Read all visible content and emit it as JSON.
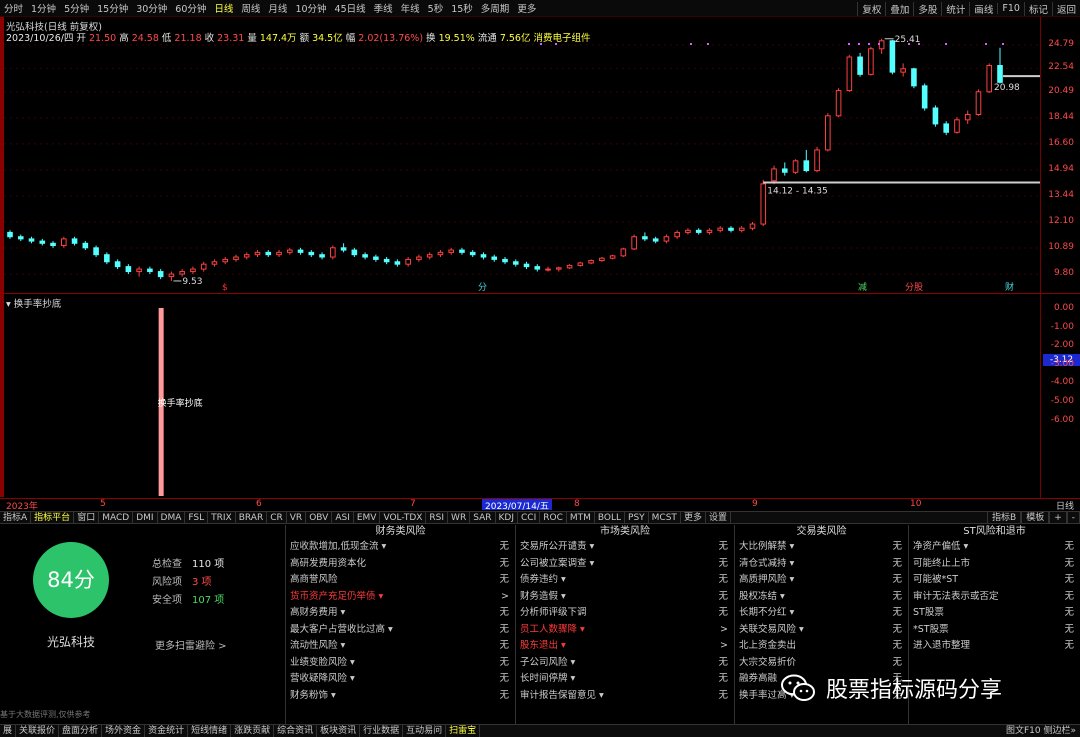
{
  "top_menu": [
    "分时",
    "1分钟",
    "5分钟",
    "15分钟",
    "30分钟",
    "60分钟",
    "日线",
    "周线",
    "月线",
    "10分钟",
    "45日线",
    "季线",
    "年线",
    "5秒",
    "15秒",
    "多周期",
    "更多"
  ],
  "top_menu_active": 6,
  "top_right": [
    "复权",
    "叠加",
    "多股",
    "统计",
    "画线",
    "F10",
    "标记",
    "返回"
  ],
  "info": {
    "title": "光弘科技(日线 前复权)",
    "date": "2023/10/26/四",
    "open_label": "开",
    "open": "21.50",
    "high_label": "高",
    "high": "24.58",
    "low_label": "低",
    "low": "21.18",
    "close_label": "收",
    "close": "23.31",
    "vol_label": "量",
    "vol": "147.4万",
    "amt_label": "额",
    "amt": "34.5亿",
    "chg_label": "幅",
    "chg": "2.02(13.76%)",
    "turn_label": "换",
    "turn": "19.51%",
    "float_label": "流通",
    "float": "7.56亿",
    "concept": "消费电子组件"
  },
  "price_axis": [
    "24.79",
    "22.54",
    "20.49",
    "18.44",
    "16.60",
    "14.94",
    "13.44",
    "12.10",
    "10.89",
    "9.80"
  ],
  "chart_annotations": {
    "high_label": "25.41",
    "low_label": "9.53",
    "gap_label": "14.12 - 14.35",
    "right_label": "20.98"
  },
  "event_marks": [
    "$",
    "分",
    "减",
    "分股",
    "财"
  ],
  "indicator": {
    "title": "换手率抄底",
    "bar_label": "换手率抄底",
    "axis": [
      "0.00",
      "-1.00",
      "-2.00",
      "-3.00",
      "-4.00",
      "-5.00",
      "-6.00"
    ],
    "current": "-3.12"
  },
  "date_axis": {
    "labels": [
      "2023年",
      "5",
      "6",
      "7",
      "8",
      "9",
      "10"
    ],
    "cursor": "2023/07/14/五",
    "right": "日线"
  },
  "tabs": [
    "指标A",
    "指标平台",
    "窗口",
    "MACD",
    "DMI",
    "DMA",
    "FSL",
    "TRIX",
    "BRAR",
    "CR",
    "VR",
    "OBV",
    "ASI",
    "EMV",
    "VOL-TDX",
    "RSI",
    "WR",
    "SAR",
    "KDJ",
    "CCI",
    "ROC",
    "MTM",
    "BOLL",
    "PSY",
    "MCST",
    "更多",
    "设置"
  ],
  "tabs_active": 1,
  "tabs_right": [
    "指标B",
    "模板",
    "+",
    "-"
  ],
  "risk": {
    "score": "84分",
    "stock_name": "光弘科技",
    "total_label": "总检查",
    "total_value": "110 项",
    "risk_label": "风险项",
    "risk_value": "3 项",
    "safe_label": "安全项",
    "safe_value": "107 项",
    "more_label": "更多扫雷避险 >",
    "disclaimer": "基于大数据评测,仅供参考",
    "columns": [
      {
        "title": "财务类风险",
        "items": [
          {
            "name": "应收款增加,低现金流 ▾",
            "status": "无",
            "warn": false
          },
          {
            "name": "高研发费用资本化",
            "status": "无",
            "warn": false
          },
          {
            "name": "高商誉风险",
            "status": "无",
            "warn": false
          },
          {
            "name": "货币资产充足仍举债 ▾",
            "status": ">",
            "warn": true
          },
          {
            "name": "高财务费用 ▾",
            "status": "无",
            "warn": false
          },
          {
            "name": "最大客户占营收比过高 ▾",
            "status": "无",
            "warn": false
          },
          {
            "name": "流动性风险 ▾",
            "status": "无",
            "warn": false
          },
          {
            "name": "业绩变脸风险 ▾",
            "status": "无",
            "warn": false
          },
          {
            "name": "营收疑降风险 ▾",
            "status": "无",
            "warn": false
          },
          {
            "name": "财务粉饰 ▾",
            "status": "无",
            "warn": false
          }
        ]
      },
      {
        "title": "市场类风险",
        "items": [
          {
            "name": "交易所公开谴责 ▾",
            "status": "无",
            "warn": false
          },
          {
            "name": "公司被立案调查 ▾",
            "status": "无",
            "warn": false
          },
          {
            "name": "债券违约 ▾",
            "status": "无",
            "warn": false
          },
          {
            "name": "财务造假 ▾",
            "status": "无",
            "warn": false
          },
          {
            "name": "分析师评级下调",
            "status": "无",
            "warn": false
          },
          {
            "name": "员工人数骤降 ▾",
            "status": ">",
            "warn": true
          },
          {
            "name": "股东退出 ▾",
            "status": ">",
            "warn": true
          },
          {
            "name": "子公司风险 ▾",
            "status": "无",
            "warn": false
          },
          {
            "name": "长时间停牌 ▾",
            "status": "无",
            "warn": false
          },
          {
            "name": "审计报告保留意见 ▾",
            "status": "无",
            "warn": false
          }
        ]
      },
      {
        "title": "交易类风险",
        "items": [
          {
            "name": "大比例解禁 ▾",
            "status": "无",
            "warn": false
          },
          {
            "name": "清仓式减持 ▾",
            "status": "无",
            "warn": false
          },
          {
            "name": "高质押风险 ▾",
            "status": "无",
            "warn": false
          },
          {
            "name": "股权冻结 ▾",
            "status": "无",
            "warn": false
          },
          {
            "name": "长期不分红 ▾",
            "status": "无",
            "warn": false
          },
          {
            "name": "关联交易风险 ▾",
            "status": "无",
            "warn": false
          },
          {
            "name": "北上资金卖出",
            "status": "无",
            "warn": false
          },
          {
            "name": "大宗交易折价",
            "status": "无",
            "warn": false
          },
          {
            "name": "融券高融",
            "status": "无",
            "warn": false
          },
          {
            "name": "换手率过高 ▾",
            "status": "无",
            "warn": false
          }
        ]
      },
      {
        "title": "ST风险和退市",
        "items": [
          {
            "name": "净资产偏低 ▾",
            "status": "无",
            "warn": false
          },
          {
            "name": "可能终止上市",
            "status": "无",
            "warn": false
          },
          {
            "name": "可能被*ST",
            "status": "无",
            "warn": false
          },
          {
            "name": "审计无法表示或否定",
            "status": "无",
            "warn": false
          },
          {
            "name": "ST股票",
            "status": "无",
            "warn": false
          },
          {
            "name": "*ST股票",
            "status": "无",
            "warn": false
          },
          {
            "name": "进入退市整理",
            "status": "无",
            "warn": false
          }
        ]
      }
    ]
  },
  "watermark": "股票指标源码分享",
  "bottom_bar": [
    "展",
    "关联报价",
    "盘面分析",
    "场外资金",
    "资金统计",
    "短线情绪",
    "涨跌贡献",
    "综合资讯",
    "板块资讯",
    "行业数据",
    "互动易问",
    "扫雷宝"
  ],
  "bottom_active": 11,
  "bottom_right": "图文F10  侧边栏»",
  "chart_data": {
    "type": "candlestick",
    "ylim": [
      9.3,
      25.8
    ],
    "y_scale": "log",
    "candles": [
      [
        11.6,
        11.7,
        11.3,
        11.4
      ],
      [
        11.4,
        11.5,
        11.2,
        11.3
      ],
      [
        11.3,
        11.4,
        11.1,
        11.2
      ],
      [
        11.2,
        11.3,
        11.0,
        11.1
      ],
      [
        11.1,
        11.2,
        10.9,
        11.0
      ],
      [
        11.0,
        11.4,
        10.9,
        11.3
      ],
      [
        11.3,
        11.4,
        11.0,
        11.1
      ],
      [
        11.1,
        11.2,
        10.8,
        10.9
      ],
      [
        10.9,
        11.0,
        10.5,
        10.6
      ],
      [
        10.6,
        10.7,
        10.2,
        10.3
      ],
      [
        10.3,
        10.4,
        10.0,
        10.1
      ],
      [
        10.1,
        10.2,
        9.8,
        9.9
      ],
      [
        9.9,
        10.1,
        9.7,
        10.0
      ],
      [
        10.0,
        10.1,
        9.8,
        9.9
      ],
      [
        9.9,
        10.0,
        9.6,
        9.7
      ],
      [
        9.7,
        9.9,
        9.53,
        9.8
      ],
      [
        9.8,
        10.0,
        9.7,
        9.9
      ],
      [
        9.9,
        10.1,
        9.8,
        10.0
      ],
      [
        10.0,
        10.3,
        9.9,
        10.2
      ],
      [
        10.2,
        10.4,
        10.1,
        10.3
      ],
      [
        10.3,
        10.5,
        10.2,
        10.4
      ],
      [
        10.4,
        10.6,
        10.3,
        10.5
      ],
      [
        10.5,
        10.7,
        10.4,
        10.6
      ],
      [
        10.6,
        10.8,
        10.5,
        10.7
      ],
      [
        10.7,
        10.8,
        10.5,
        10.6
      ],
      [
        10.6,
        10.8,
        10.5,
        10.7
      ],
      [
        10.7,
        10.9,
        10.6,
        10.8
      ],
      [
        10.8,
        10.9,
        10.6,
        10.7
      ],
      [
        10.7,
        10.8,
        10.5,
        10.6
      ],
      [
        10.6,
        10.7,
        10.4,
        10.5
      ],
      [
        10.5,
        11.0,
        10.4,
        10.9
      ],
      [
        10.9,
        11.1,
        10.7,
        10.8
      ],
      [
        10.8,
        10.9,
        10.5,
        10.6
      ],
      [
        10.6,
        10.7,
        10.4,
        10.5
      ],
      [
        10.5,
        10.6,
        10.3,
        10.4
      ],
      [
        10.4,
        10.5,
        10.2,
        10.3
      ],
      [
        10.3,
        10.4,
        10.1,
        10.2
      ],
      [
        10.2,
        10.5,
        10.1,
        10.4
      ],
      [
        10.4,
        10.6,
        10.3,
        10.5
      ],
      [
        10.5,
        10.7,
        10.4,
        10.6
      ],
      [
        10.6,
        10.8,
        10.5,
        10.7
      ],
      [
        10.7,
        10.9,
        10.6,
        10.8
      ],
      [
        10.8,
        10.9,
        10.6,
        10.7
      ],
      [
        10.7,
        10.8,
        10.5,
        10.6
      ],
      [
        10.6,
        10.7,
        10.4,
        10.5
      ],
      [
        10.5,
        10.6,
        10.3,
        10.4
      ],
      [
        10.4,
        10.5,
        10.2,
        10.3
      ],
      [
        10.3,
        10.4,
        10.1,
        10.2
      ],
      [
        10.2,
        10.3,
        10.0,
        10.1
      ],
      [
        10.1,
        10.2,
        9.9,
        10.0
      ],
      [
        10.0,
        10.1,
        9.9,
        10.0
      ],
      [
        10.0,
        10.1,
        9.9,
        10.05
      ],
      [
        10.05,
        10.2,
        10.0,
        10.15
      ],
      [
        10.15,
        10.3,
        10.1,
        10.25
      ],
      [
        10.25,
        10.4,
        10.2,
        10.35
      ],
      [
        10.35,
        10.5,
        10.3,
        10.45
      ],
      [
        10.45,
        10.6,
        10.4,
        10.55
      ],
      [
        10.55,
        10.9,
        10.5,
        10.85
      ],
      [
        10.85,
        11.5,
        10.8,
        11.4
      ],
      [
        11.4,
        11.6,
        11.2,
        11.3
      ],
      [
        11.3,
        11.4,
        11.1,
        11.2
      ],
      [
        11.2,
        11.5,
        11.1,
        11.4
      ],
      [
        11.4,
        11.7,
        11.3,
        11.6
      ],
      [
        11.6,
        11.8,
        11.5,
        11.7
      ],
      [
        11.7,
        11.8,
        11.5,
        11.6
      ],
      [
        11.6,
        11.8,
        11.5,
        11.7
      ],
      [
        11.7,
        11.9,
        11.6,
        11.8
      ],
      [
        11.8,
        11.9,
        11.6,
        11.7
      ],
      [
        11.7,
        11.9,
        11.6,
        11.8
      ],
      [
        11.8,
        12.1,
        11.7,
        12.0
      ],
      [
        12.0,
        14.35,
        11.9,
        14.12
      ],
      [
        14.3,
        15.2,
        14.1,
        15.0
      ],
      [
        15.0,
        15.4,
        14.6,
        14.8
      ],
      [
        14.8,
        15.6,
        14.7,
        15.5
      ],
      [
        15.5,
        16.2,
        14.8,
        14.9
      ],
      [
        14.9,
        16.4,
        14.8,
        16.2
      ],
      [
        16.2,
        18.8,
        16.1,
        18.6
      ],
      [
        18.6,
        20.8,
        18.5,
        20.6
      ],
      [
        20.6,
        23.8,
        20.5,
        23.6
      ],
      [
        23.6,
        24.0,
        21.8,
        22.0
      ],
      [
        22.0,
        24.6,
        21.9,
        24.4
      ],
      [
        24.4,
        25.41,
        23.9,
        25.2
      ],
      [
        25.2,
        25.3,
        22.0,
        22.2
      ],
      [
        22.2,
        23.0,
        21.8,
        22.5
      ],
      [
        22.5,
        22.6,
        20.8,
        21.0
      ],
      [
        21.0,
        21.2,
        19.0,
        19.2
      ],
      [
        19.2,
        19.4,
        17.8,
        18.0
      ],
      [
        18.0,
        18.2,
        17.2,
        17.4
      ],
      [
        17.4,
        18.5,
        17.3,
        18.3
      ],
      [
        18.3,
        19.0,
        18.0,
        18.7
      ],
      [
        18.7,
        20.7,
        18.6,
        20.5
      ],
      [
        20.5,
        23.0,
        20.4,
        22.8
      ],
      [
        22.8,
        24.5,
        21.2,
        21.3
      ]
    ],
    "indicator_bar_index": 14
  }
}
